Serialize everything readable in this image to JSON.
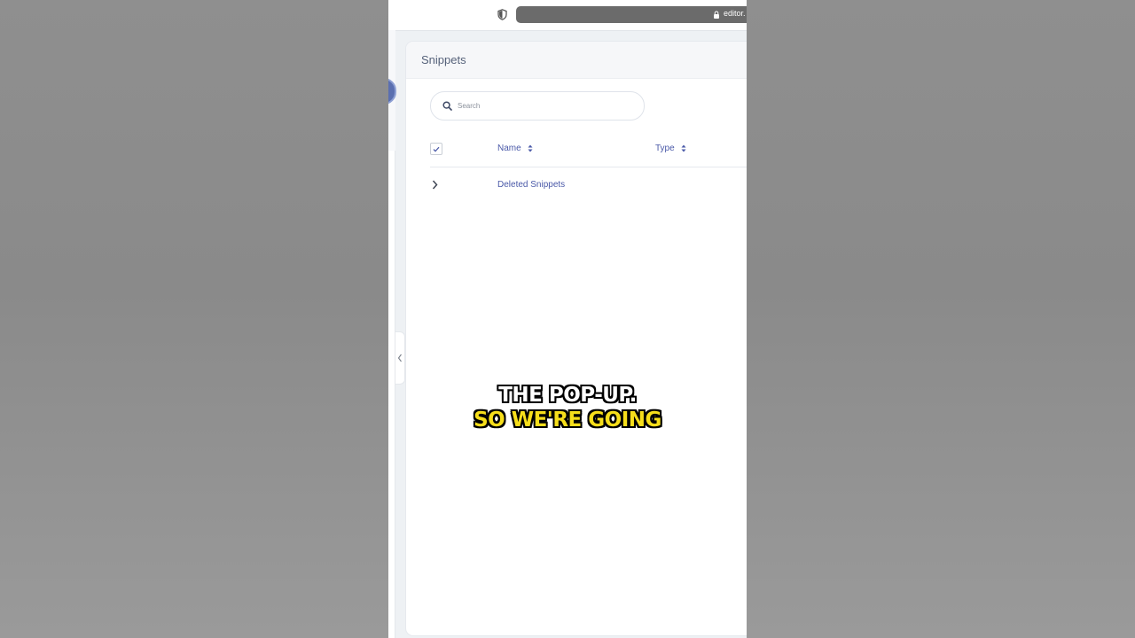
{
  "browser": {
    "url": "editor."
  },
  "panel": {
    "title": "Snippets",
    "search": {
      "value": "",
      "placeholder": "Search"
    },
    "table": {
      "columns": [
        {
          "label": "Name",
          "sortable": true
        },
        {
          "label": "Type",
          "sortable": true
        }
      ],
      "rows": [
        {
          "name": "Deleted Snippets",
          "expandable": true
        }
      ]
    }
  },
  "caption": {
    "line1": "THE POP-UP.",
    "line2": "SO WE'RE GOING"
  },
  "colors": {
    "accent": "#4a59a8",
    "caption_highlight": "#f6de1b"
  }
}
